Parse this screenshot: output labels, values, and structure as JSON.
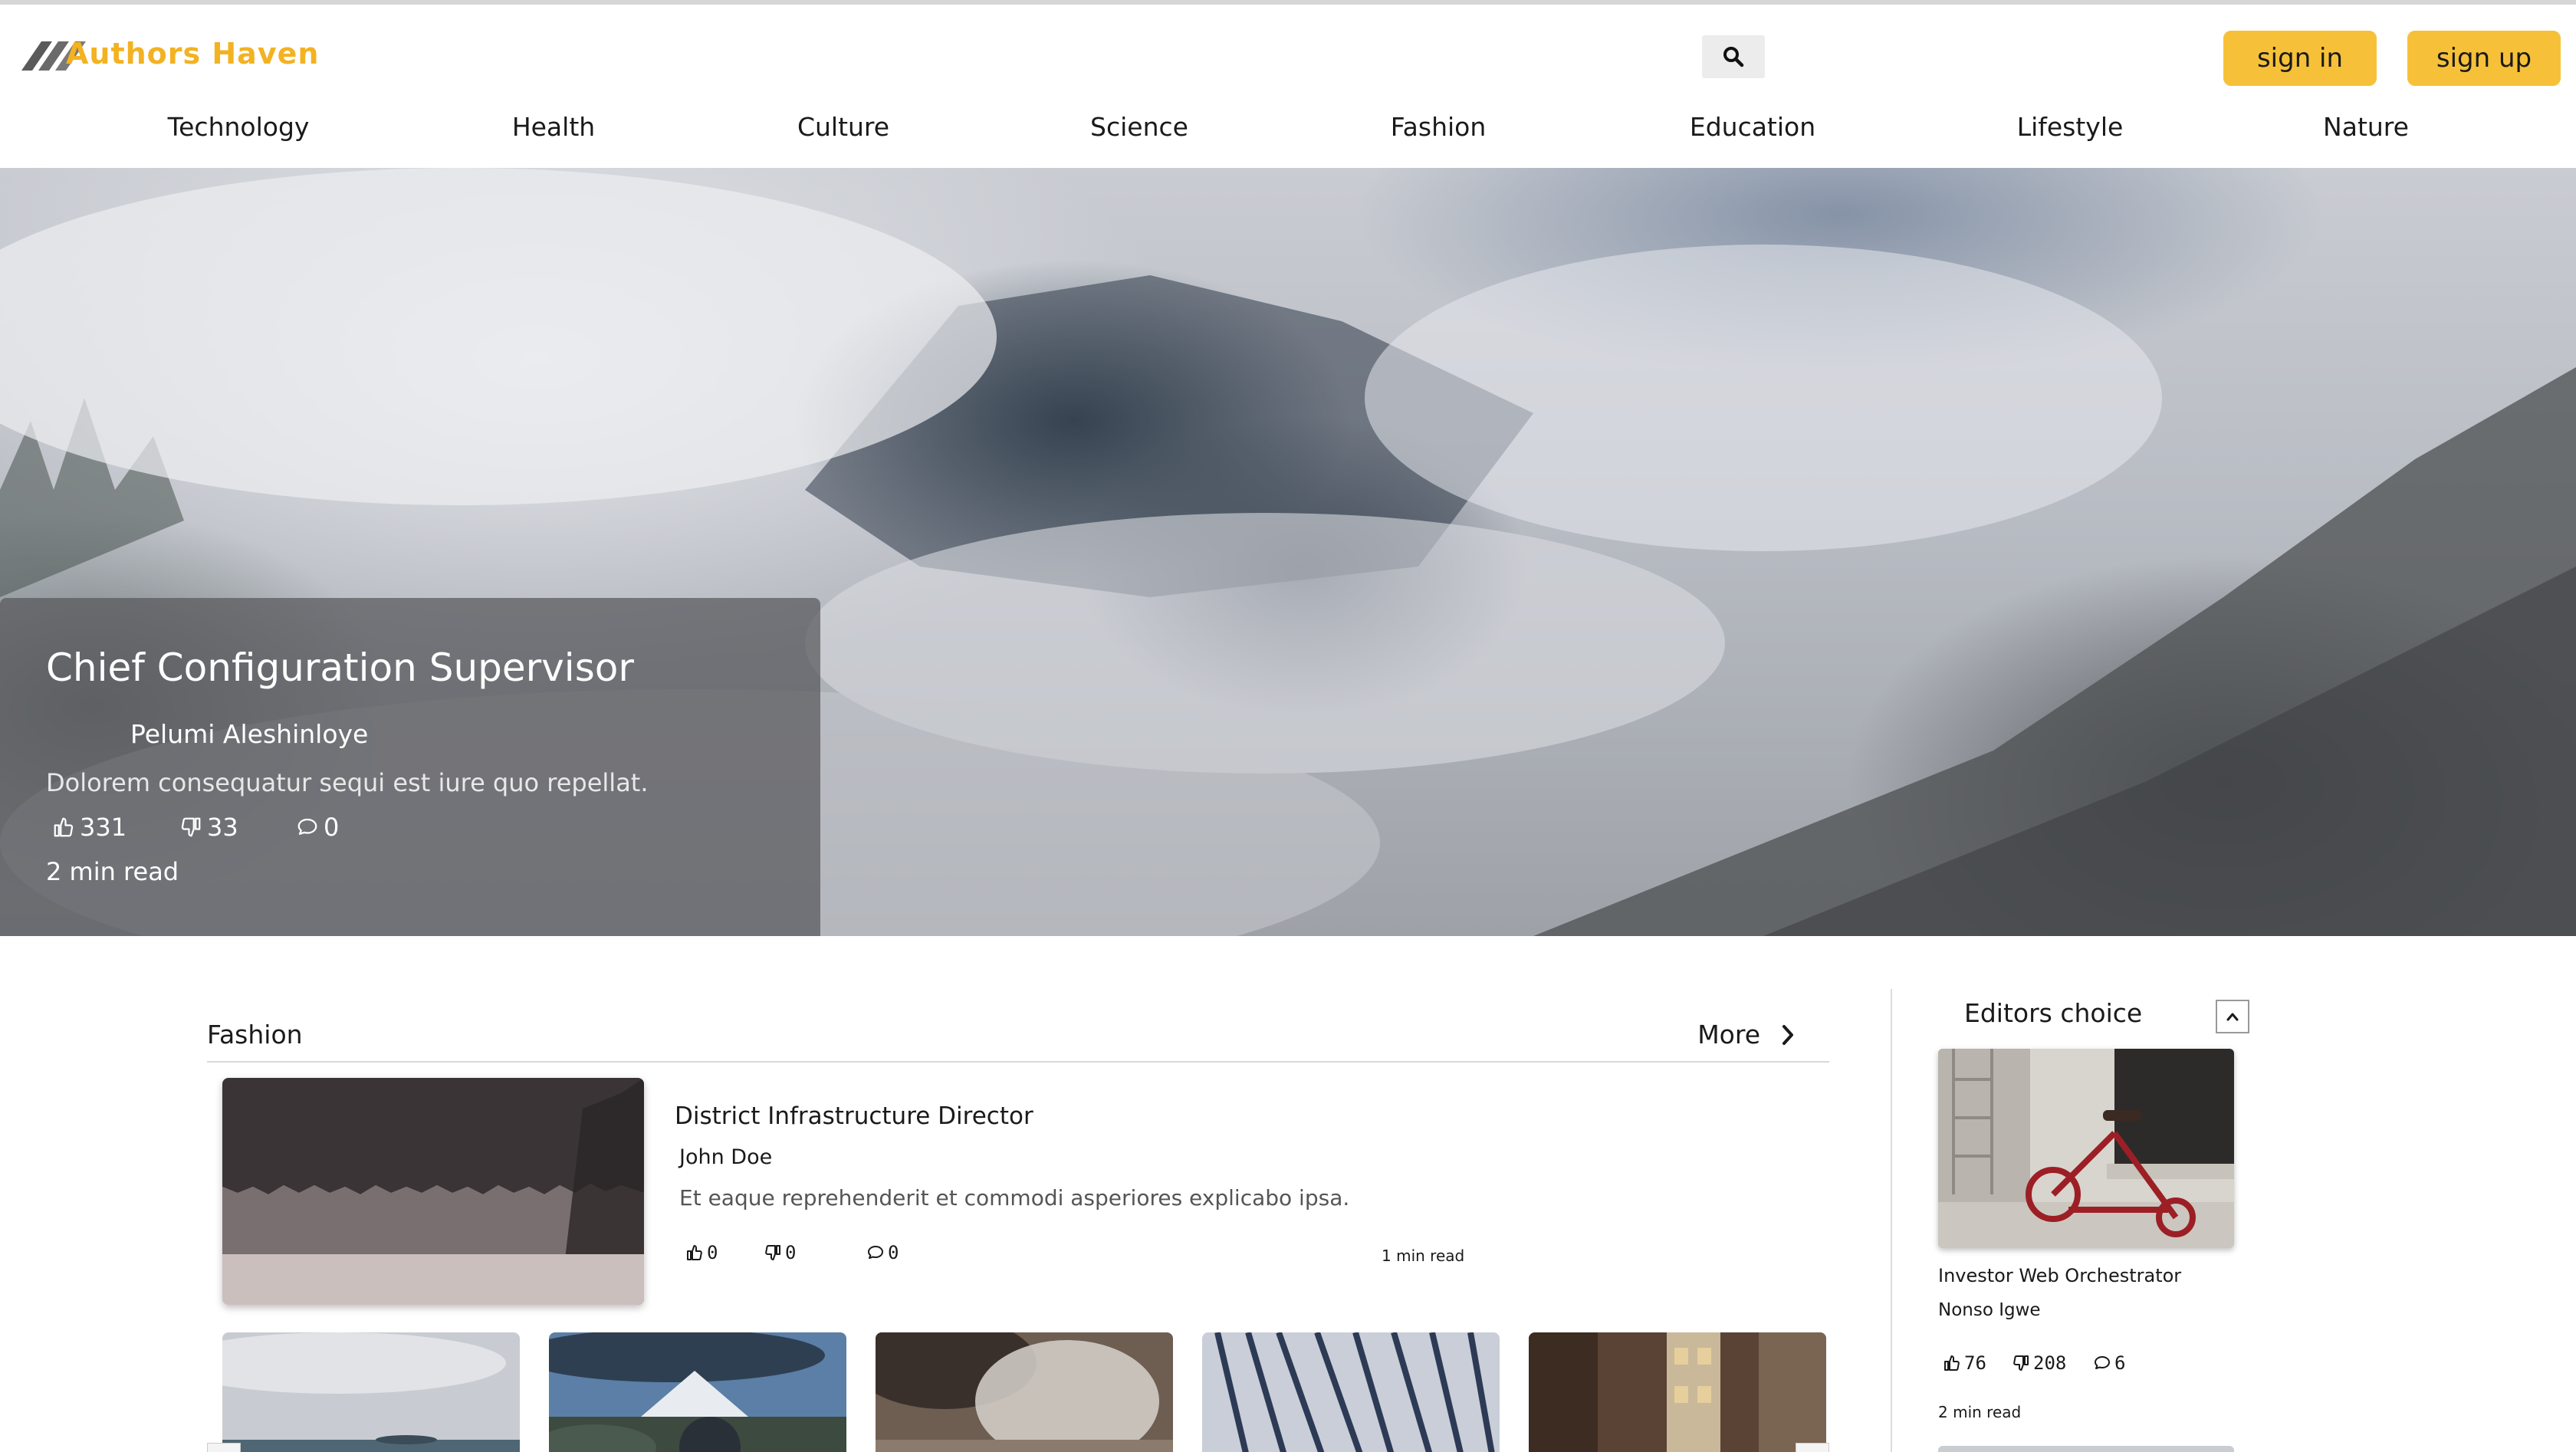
{
  "header": {
    "logo_text": "Authors Haven",
    "search_icon": "search-icon",
    "sign_in_label": "sign in",
    "sign_up_label": "sign up"
  },
  "nav": {
    "items": [
      {
        "label": "Technology"
      },
      {
        "label": "Health"
      },
      {
        "label": "Culture"
      },
      {
        "label": "Science"
      },
      {
        "label": "Fashion"
      },
      {
        "label": "Education"
      },
      {
        "label": "Lifestyle"
      },
      {
        "label": "Nature"
      }
    ]
  },
  "hero": {
    "title": "Chief Configuration Supervisor",
    "author": "Pelumi Aleshinloye",
    "description": "Dolorem consequatur sequi est iure quo repellat.",
    "likes": "331",
    "dislikes": "33",
    "comments": "0",
    "read_time": "2 min read"
  },
  "section": {
    "title": "Fashion",
    "more_label": "More",
    "featured": {
      "title": "District Infrastructure Director",
      "author": "John Doe",
      "description": "Et eaque reprehenderit et commodi asperiores explicabo ipsa.",
      "likes": "0",
      "dislikes": "0",
      "comments": "0",
      "read_time": "1 min read"
    }
  },
  "editors_choice": {
    "title": "Editors choice",
    "article": {
      "title": "Investor Web Orchestrator",
      "author": "Nonso Igwe",
      "likes": "76",
      "dislikes": "208",
      "comments": "6",
      "read_time": "2 min read"
    }
  },
  "colors": {
    "brand_yellow": "#f6c139",
    "logo_text": "#f3b221"
  }
}
